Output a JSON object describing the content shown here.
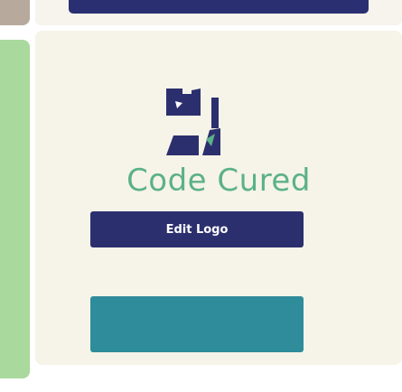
{
  "brand": {
    "name": "Code Cured",
    "logo_icon": "cat-face-logo-icon",
    "colors": {
      "primary": "#2c2f6e",
      "brand_text": "#5cb189",
      "card_bg": "#f6f4e8",
      "teal": "#2f8c9a",
      "swatch_green": "#a9d99c",
      "swatch_tan": "#b7a99c"
    }
  },
  "actions": {
    "edit_logo_label": "Edit Logo"
  }
}
